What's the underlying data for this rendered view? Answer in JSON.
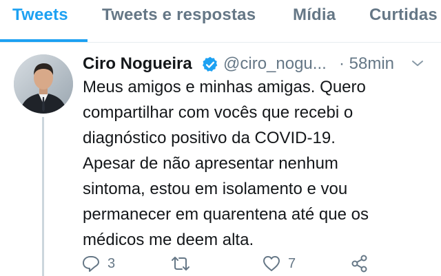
{
  "tabs": [
    {
      "label": "Tweets"
    },
    {
      "label": "Tweets e respostas"
    },
    {
      "label": "Mídia"
    },
    {
      "label": "Curtidas"
    }
  ],
  "tweet": {
    "author_name": "Ciro Nogueira",
    "handle": "@ciro_nogu...",
    "time": "· 58min",
    "text": "Meus amigos e minhas amigas. Quero\ncompartilhar com vocês que recebi o\ndiagnóstico positivo da COVID-19.\nApesar de não apresentar nenhum\nsintoma, estou em isolamento e vou\npermanecer em quarentena até que os\nmédicos me deem alta.",
    "reply_count": "3",
    "like_count": "7"
  },
  "icons": {
    "verified": "verified-badge-icon",
    "caret": "chevron-down-icon",
    "reply": "reply-icon",
    "retweet": "retweet-icon",
    "like": "heart-icon",
    "share": "share-icon"
  },
  "colors": {
    "accent": "#1da1f2",
    "text": "#14171a",
    "muted": "#657786"
  }
}
